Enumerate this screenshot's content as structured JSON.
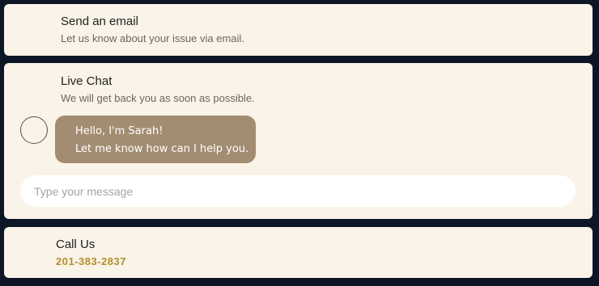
{
  "email": {
    "title": "Send an email",
    "subtitle": "Let us know about your issue via email."
  },
  "chat": {
    "title": "Live Chat",
    "subtitle": "We will get back you as soon as possible.",
    "message_line1": "Hello, I'm Sarah!",
    "message_line2": "Let me know how can I help you.",
    "input_placeholder": "Type your message",
    "bubble_color": "#a38d72"
  },
  "call": {
    "title": "Call Us",
    "phone": "201-383-2837",
    "phone_color": "#b0902f"
  },
  "colors": {
    "background": "#0c1626",
    "card": "#faf3e7"
  }
}
